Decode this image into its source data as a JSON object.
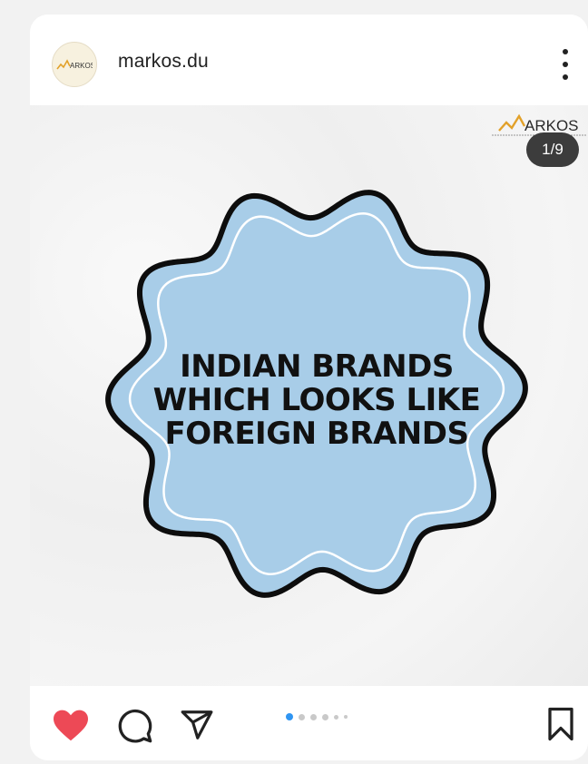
{
  "header": {
    "username": "markos.du",
    "avatar_text": "ARKOS"
  },
  "post": {
    "corner_logo_text": "ARKOS",
    "counter": "1/9",
    "badge_lines": [
      "INDIAN BRANDS",
      "WHICH LOOKS LIKE",
      "FOREIGN BRANDS"
    ],
    "badge_color": "#a8cde8",
    "slides_total": 9,
    "current_slide": 1
  },
  "actions": {
    "like_color": "#ed4956",
    "icons": [
      "heart-icon",
      "comment-icon",
      "share-icon",
      "bookmark-icon"
    ]
  }
}
